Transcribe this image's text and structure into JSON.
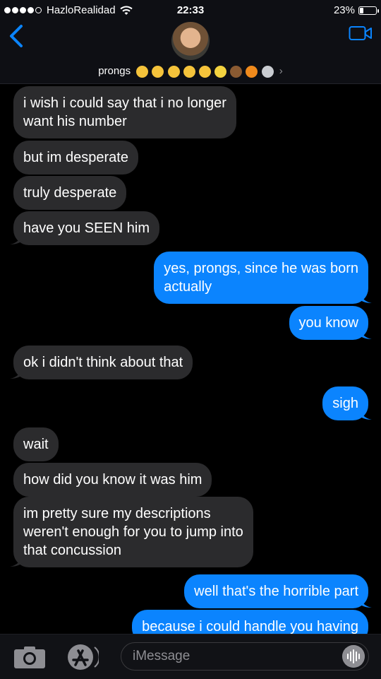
{
  "status_bar": {
    "carrier": "HazloRealidad",
    "time": "22:33",
    "battery_percent": "23%",
    "signal_bars": 4,
    "battery_level": 0.23
  },
  "header": {
    "contact_name": "prongs",
    "emoji_count": 10
  },
  "messages": [
    {
      "dir": "in",
      "lines": [
        "i wish i could say that i no longer",
        "want his number"
      ]
    },
    {
      "dir": "in",
      "lines": [
        "but im desperate"
      ]
    },
    {
      "dir": "in",
      "lines": [
        "truly desperate"
      ]
    },
    {
      "dir": "in",
      "lines": [
        "have you SEEN him"
      ]
    },
    {
      "dir": "out",
      "lines": [
        "yes, prongs, since he was born",
        "actually"
      ]
    },
    {
      "dir": "out",
      "lines": [
        "you know"
      ]
    },
    {
      "dir": "in",
      "lines": [
        "ok i didn't think about that"
      ]
    },
    {
      "dir": "out",
      "lines": [
        "sigh"
      ]
    },
    {
      "dir": "in",
      "lines": [
        "wait"
      ]
    },
    {
      "dir": "in",
      "lines": [
        "how did you know it was him"
      ]
    },
    {
      "dir": "in",
      "lines": [
        "im pretty sure my descriptions",
        "weren't enough for you to jump into",
        "that concussion"
      ]
    },
    {
      "dir": "out",
      "lines": [
        "well that's the horrible part"
      ]
    },
    {
      "dir": "out",
      "lines": [
        "because i could handle you having"
      ]
    }
  ],
  "input": {
    "placeholder": "iMessage"
  },
  "icons": {
    "back": "chevron-left-icon",
    "video": "video-camera-icon",
    "camera": "camera-icon",
    "apps": "app-store-icon",
    "audio": "audio-waveform-icon"
  },
  "colors": {
    "incoming": "#2b2b2d",
    "outgoing": "#0b84fe",
    "accent": "#0a84ff",
    "background": "#000000"
  }
}
